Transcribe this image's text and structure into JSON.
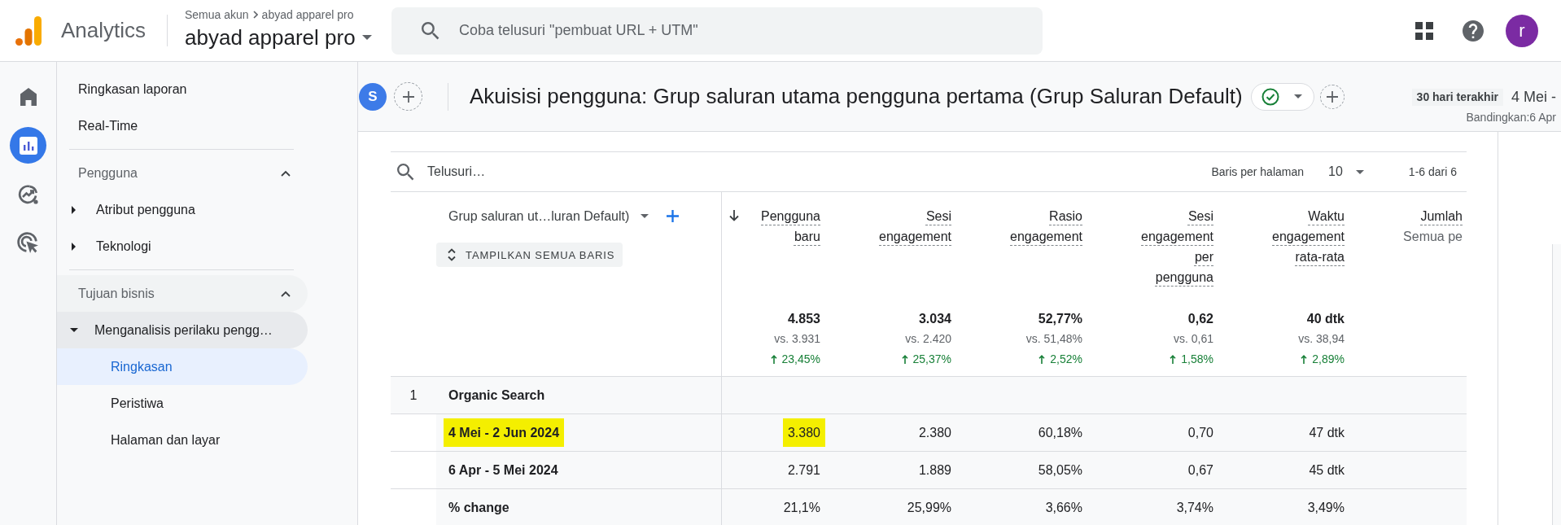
{
  "header": {
    "app_name": "Analytics",
    "breadcrumb": [
      "Semua akun",
      "abyad apparel pro"
    ],
    "property": "abyad apparel pro",
    "search": {
      "placeholder": "Coba telusuri \"pembuat URL + UTM\""
    },
    "account_initial": "r"
  },
  "rail": {
    "items": [
      {
        "kind": "home",
        "selected": false
      },
      {
        "kind": "reports",
        "selected": true
      },
      {
        "kind": "explore",
        "selected": false
      },
      {
        "kind": "advertising",
        "selected": false
      }
    ]
  },
  "nav": {
    "sections": [
      {
        "items": [
          {
            "label": "Ringkasan laporan",
            "selected": false
          },
          {
            "label": "Real-Time",
            "selected": false
          }
        ]
      },
      {
        "title": "Pengguna",
        "expanded": true,
        "items": [
          {
            "label": "Atribut pengguna",
            "selected": false,
            "expanded": false
          },
          {
            "label": "Teknologi",
            "selected": false,
            "expanded": false
          }
        ]
      },
      {
        "title": "Tujuan bisnis",
        "expanded": true,
        "items": [
          {
            "label": "Menganalisis perilaku pengg…",
            "selected": false,
            "expanded": true,
            "children": [
              {
                "label": "Ringkasan",
                "selected": true
              },
              {
                "label": "Peristiwa",
                "selected": false
              },
              {
                "label": "Halaman dan layar",
                "selected": false
              }
            ]
          }
        ]
      }
    ]
  },
  "report": {
    "comparison": {
      "initial": "S"
    },
    "title": "Akuisisi pengguna: Grup saluran utama pengguna pertama (Grup Saluran Default)",
    "date": {
      "preset": "30 hari terakhir",
      "range": "4 Mei -",
      "compare": "Bandingkan:6 Apr"
    }
  },
  "table": {
    "search": {
      "placeholder": "Telusuri…"
    },
    "rows_per_page": {
      "label": "Baris per halaman",
      "value": "10"
    },
    "pagination": "1-6 dari 6",
    "dimension": {
      "label": "Grup saluran ut…luran Default)",
      "button": "TAMPILKAN SEMUA BARIS"
    },
    "columns": [
      {
        "label": "Pengguna baru",
        "sorted": true,
        "total": "4.853",
        "compare": "vs. 3.931",
        "change": "23,45%",
        "rising": true
      },
      {
        "label": "Sesi engagement",
        "sorted": false,
        "total": "3.034",
        "compare": "vs. 2.420",
        "change": "25,37%",
        "rising": true
      },
      {
        "label": "Rasio engagement",
        "sorted": false,
        "total": "52,77%",
        "compare": "vs. 51,48%",
        "change": "2,52%",
        "rising": true
      },
      {
        "label": "Sesi engagement per pengguna",
        "sorted": false,
        "total": "0,62",
        "compare": "vs. 0,61",
        "change": "1,58%",
        "rising": true
      },
      {
        "label": "Waktu engagement rata-rata",
        "sorted": false,
        "total": "40 dtk",
        "compare": "vs. 38,94",
        "change": "2,89%",
        "rising": true
      },
      {
        "label": "Jumlah",
        "sorted": false,
        "subtitle": "Semua pe"
      }
    ],
    "groups": [
      {
        "index": "1",
        "name": "Organic Search",
        "rows": [
          {
            "label": "4 Mei - 2 Jun 2024",
            "highlighted": true,
            "cells": [
              {
                "text": "3.380",
                "highlighted": true
              },
              {
                "text": "2.380",
                "highlighted": false
              },
              {
                "text": "60,18%",
                "highlighted": false
              },
              {
                "text": "0,70",
                "highlighted": false
              },
              {
                "text": "47 dtk",
                "highlighted": false
              }
            ]
          },
          {
            "label": "6 Apr - 5 Mei 2024",
            "highlighted": false,
            "cells": [
              {
                "text": "2.791",
                "highlighted": false
              },
              {
                "text": "1.889",
                "highlighted": false
              },
              {
                "text": "58,05%",
                "highlighted": false
              },
              {
                "text": "0,67",
                "highlighted": false
              },
              {
                "text": "45 dtk",
                "highlighted": false
              }
            ]
          },
          {
            "label": "% change",
            "highlighted": false,
            "cells": [
              {
                "text": "21,1%",
                "highlighted": false
              },
              {
                "text": "25,99%",
                "highlighted": false
              },
              {
                "text": "3,66%",
                "highlighted": false
              },
              {
                "text": "3,74%",
                "highlighted": false
              },
              {
                "text": "3,49%",
                "highlighted": false
              }
            ]
          }
        ]
      }
    ]
  }
}
